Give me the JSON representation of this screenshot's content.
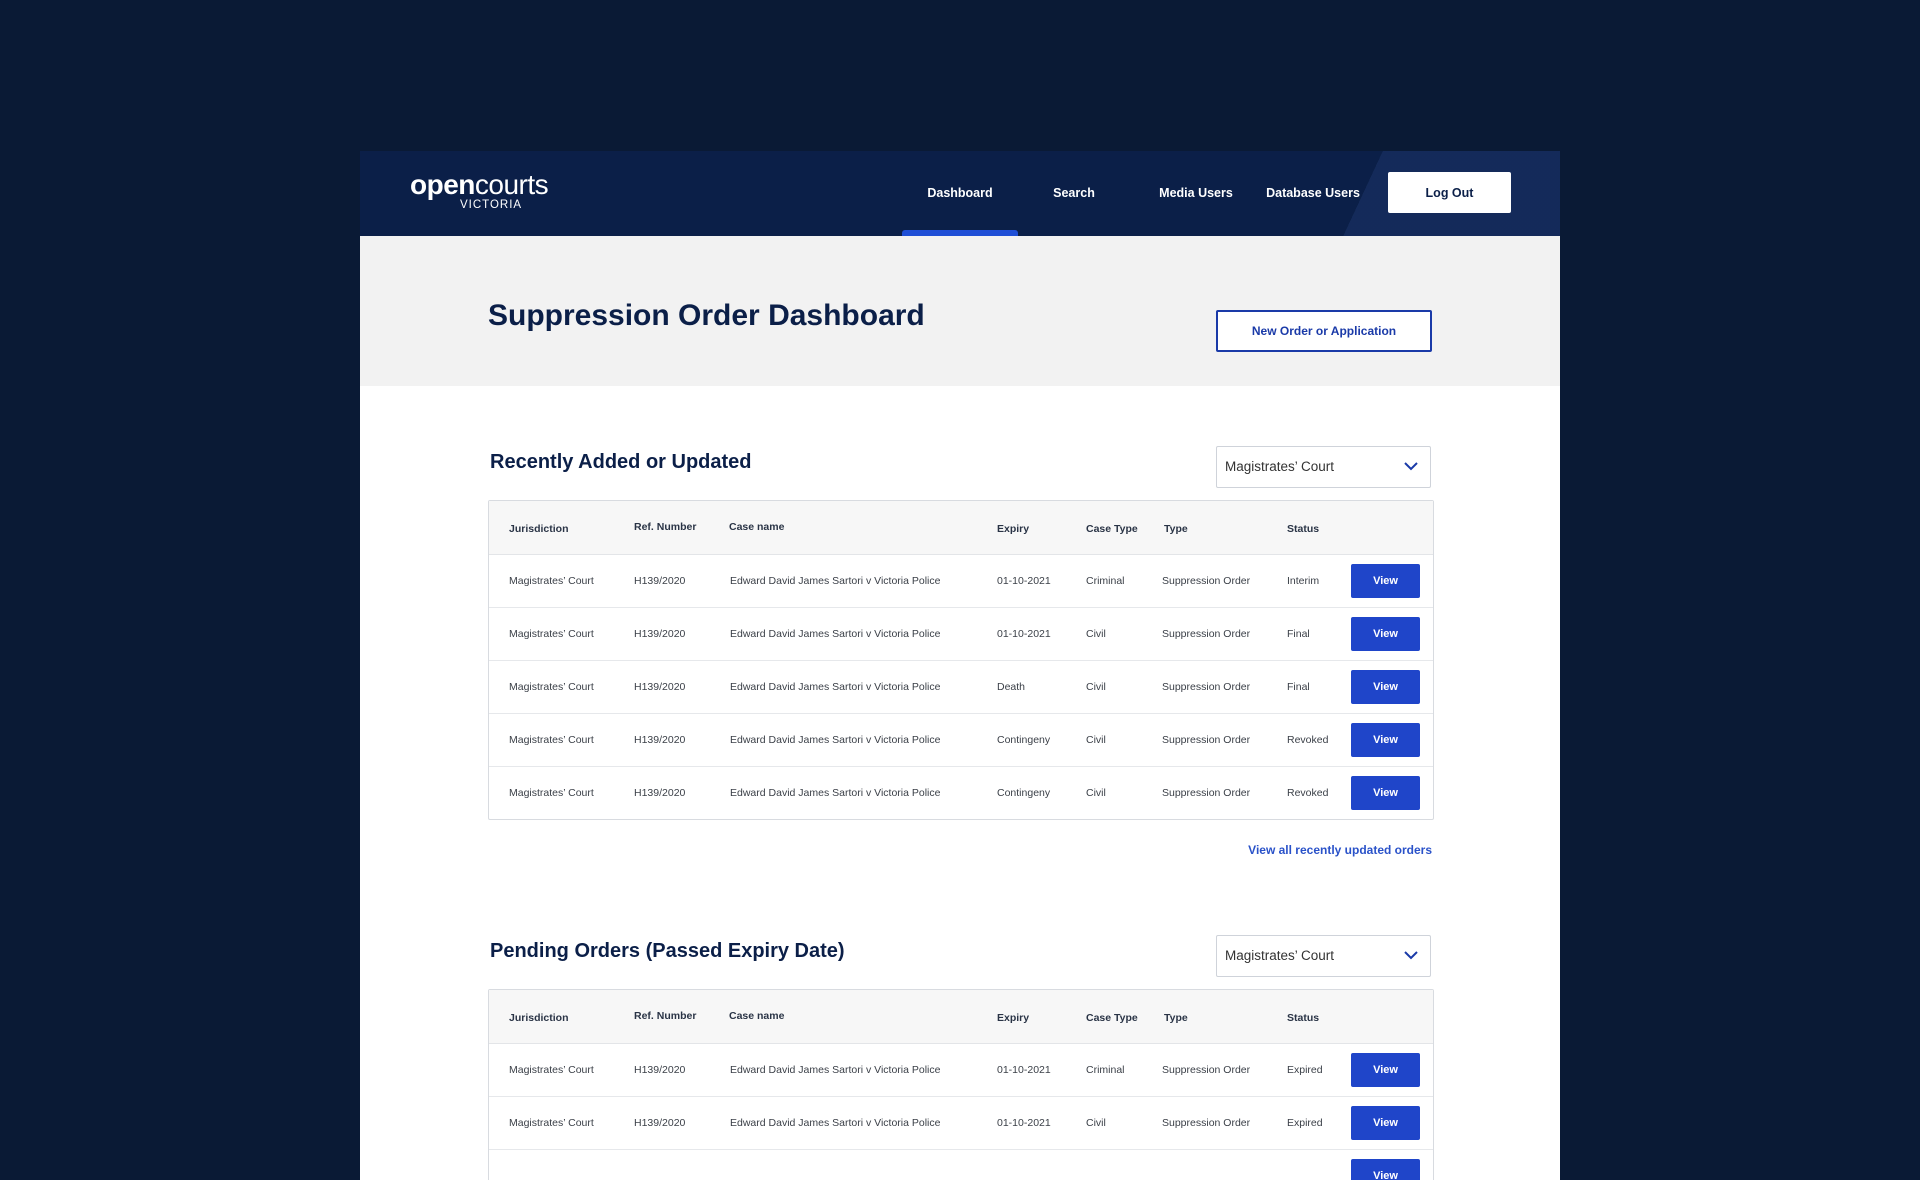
{
  "header": {
    "logo_open": "open",
    "logo_courts": "courts",
    "logo_sub": "VICTORIA",
    "nav": [
      {
        "label": "Dashboard",
        "active": true
      },
      {
        "label": "Search",
        "active": false
      },
      {
        "label": "Media Users",
        "active": false
      },
      {
        "label": "Database Users",
        "active": false
      }
    ],
    "logout_label": "Log Out"
  },
  "page": {
    "title": "Suppression Order Dashboard",
    "new_order_label": "New Order or Application"
  },
  "columns": [
    "Jurisdiction",
    "Ref. Number",
    "Case name",
    "Expiry",
    "Case Type",
    "Type",
    "Status"
  ],
  "recent": {
    "title": "Recently Added or Updated",
    "filter": "Magistrates’ Court",
    "rows": [
      {
        "jurisdiction": "Magistrates’ Court",
        "ref": "H139/2020",
        "case_name": "Edward David James Sartori v Victoria Police",
        "expiry": "01-10-2021",
        "case_type": "Criminal",
        "type": "Suppression Order",
        "status": "Interim",
        "action": "View"
      },
      {
        "jurisdiction": "Magistrates’ Court",
        "ref": "H139/2020",
        "case_name": "Edward David James Sartori v Victoria Police",
        "expiry": "01-10-2021",
        "case_type": "Civil",
        "type": "Suppression Order",
        "status": "Final",
        "action": "View"
      },
      {
        "jurisdiction": "Magistrates’ Court",
        "ref": "H139/2020",
        "case_name": "Edward David James Sartori v Victoria Police",
        "expiry": "Death",
        "case_type": "Civil",
        "type": "Suppression Order",
        "status": "Final",
        "action": "View"
      },
      {
        "jurisdiction": "Magistrates’ Court",
        "ref": "H139/2020",
        "case_name": "Edward David James Sartori v Victoria Police",
        "expiry": "Contingeny",
        "case_type": "Civil",
        "type": "Suppression Order",
        "status": "Revoked",
        "action": "View"
      },
      {
        "jurisdiction": "Magistrates’ Court",
        "ref": "H139/2020",
        "case_name": "Edward David James Sartori v Victoria Police",
        "expiry": "Contingeny",
        "case_type": "Civil",
        "type": "Suppression Order",
        "status": "Revoked",
        "action": "View"
      }
    ],
    "view_all_label": "View all recently updated orders"
  },
  "pending": {
    "title": "Pending Orders (Passed Expiry Date)",
    "filter": "Magistrates’ Court",
    "rows": [
      {
        "jurisdiction": "Magistrates’ Court",
        "ref": "H139/2020",
        "case_name": "Edward David James Sartori v Victoria Police",
        "expiry": "01-10-2021",
        "case_type": "Criminal",
        "type": "Suppression Order",
        "status": "Expired",
        "action": "View"
      },
      {
        "jurisdiction": "Magistrates’ Court",
        "ref": "H139/2020",
        "case_name": "Edward David James Sartori v Victoria Police",
        "expiry": "01-10-2021",
        "case_type": "Civil",
        "type": "Suppression Order",
        "status": "Expired",
        "action": "View"
      },
      {
        "jurisdiction": "",
        "ref": "",
        "case_name": "",
        "expiry": "",
        "case_type": "",
        "type": "",
        "status": "",
        "action": "View"
      }
    ]
  },
  "colors": {
    "page_bg": "#0a1a35",
    "header_bg": "#0b1f48",
    "accent": "#1f45c9",
    "link": "#2a52c9"
  }
}
